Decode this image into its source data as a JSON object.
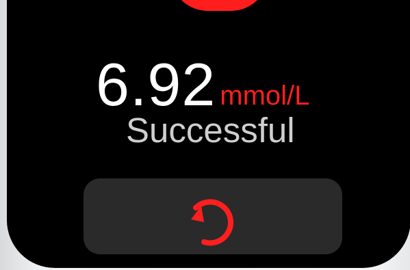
{
  "reading": {
    "value": "6.92",
    "unit": "mmol/L"
  },
  "status": {
    "text": "Successful"
  },
  "retry_button": {
    "icon": "refresh-icon"
  },
  "colors": {
    "background": "#000000",
    "accent": "#ff1f1f",
    "status_text": "#cfcfcf",
    "button": "#2a2a2a"
  }
}
